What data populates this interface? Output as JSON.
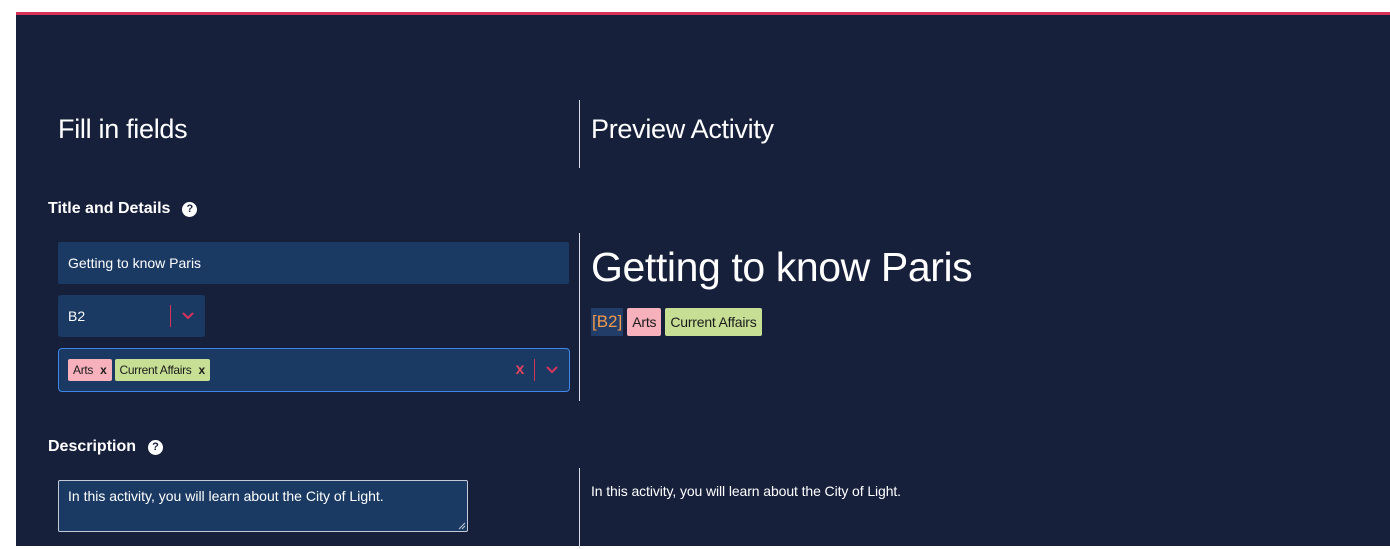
{
  "colors": {
    "background": "#17203b",
    "accent": "#d7325a",
    "field": "#1a3a63",
    "focus_border": "#3f86e8",
    "tag_arts": "#f6b1bd",
    "tag_current_affairs": "#c7df95",
    "level_text": "#f2994a"
  },
  "left": {
    "heading": "Fill in fields",
    "title_section": {
      "label": "Title and Details",
      "help_icon": "question-circle-icon",
      "title_value": "Getting to know Paris",
      "level_select": {
        "selected": "B2",
        "icon": "chevron-down-icon"
      },
      "topics": {
        "tags": [
          {
            "label": "Arts",
            "remove": "x"
          },
          {
            "label": "Current Affairs",
            "remove": "x"
          }
        ],
        "clear": "x",
        "icon": "chevron-down-icon"
      }
    },
    "description_section": {
      "label": "Description",
      "help_icon": "question-circle-icon",
      "value": "In this activity, you will learn about the City of Light."
    }
  },
  "right": {
    "heading": "Preview Activity",
    "title": "Getting to know Paris",
    "level": "[B2]",
    "tags": [
      "Arts",
      "Current Affairs"
    ],
    "description": "In this activity, you will learn about the City of Light."
  }
}
